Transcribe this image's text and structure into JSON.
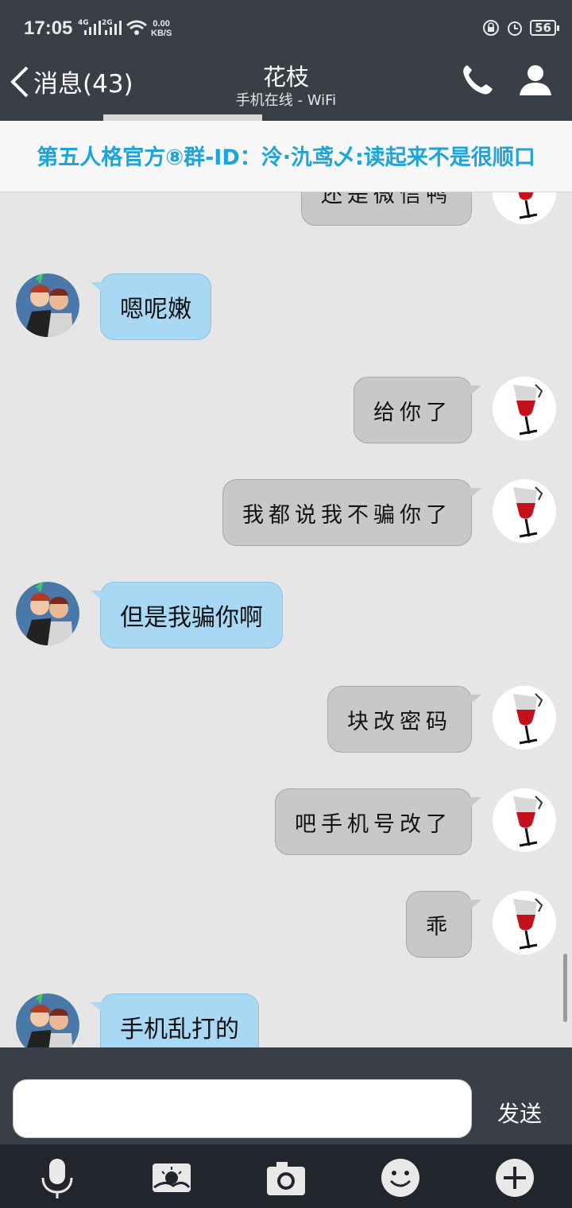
{
  "status_bar": {
    "time": "17:05",
    "network1": "4G",
    "network2": "2G",
    "speed_value": "0.00",
    "speed_unit": "KB/S",
    "battery": "56"
  },
  "header": {
    "back_label": "消息(43)",
    "title": "花枝",
    "subtitle": "手机在线 - WiFi"
  },
  "notice": {
    "text": "第五人格官方⑧群-ID：泠·氿鸢乄:读起来不是很顺口"
  },
  "messages": [
    {
      "side": "out",
      "text": "还是微信鸭"
    },
    {
      "side": "in",
      "text": "嗯呢嫩"
    },
    {
      "side": "out",
      "text": "给你了"
    },
    {
      "side": "out",
      "text": "我都说我不骗你了"
    },
    {
      "side": "in",
      "text": "但是我骗你啊"
    },
    {
      "side": "out",
      "text": "块改密码"
    },
    {
      "side": "out",
      "text": "吧手机号改了"
    },
    {
      "side": "out",
      "text": "乖"
    },
    {
      "side": "in",
      "text": "手机乱打的"
    }
  ],
  "composer": {
    "send_label": "发送",
    "input_value": ""
  },
  "icons": {
    "back": "chevron-left-icon",
    "call": "phone-icon",
    "profile": "person-icon",
    "voice": "microphone-icon",
    "image": "image-icon",
    "camera": "camera-icon",
    "emoji": "emoji-icon",
    "more": "plus-icon"
  },
  "colors": {
    "bar": "#3a3f47",
    "incoming_bubble": "#a9d8f4",
    "outgoing_bubble": "#c8c8c8",
    "notice_text": "#1ea4d6",
    "chat_background": "#e6e6e6"
  }
}
